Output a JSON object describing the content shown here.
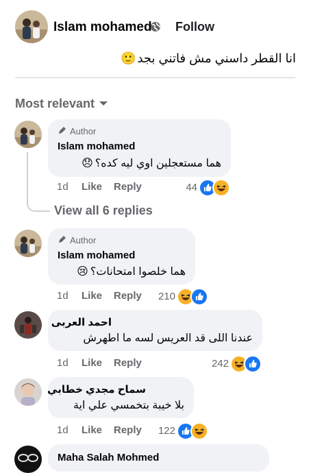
{
  "post": {
    "author": "Islam mohamed",
    "globe_icon": "globe-icon",
    "follow_label": "Follow",
    "text": "انا القطر داسني مش فاتني بجد",
    "emoji": "🙂"
  },
  "sort": {
    "label": "Most relevant",
    "icon": "caret-down-icon"
  },
  "comments": [
    {
      "author_badge": "Author",
      "name": "Islam mohamed",
      "text": "هما مستعجلين اوي ليه كده؟",
      "emoji": "😞",
      "time": "1d",
      "like": "Like",
      "reply": "Reply",
      "reaction_count": "44",
      "reactions": [
        "like",
        "haha"
      ]
    },
    {
      "author_badge": "Author",
      "name": "Islam mohamed",
      "text": "هما خلصوا امتحانات؟",
      "emoji": "😢",
      "time": "1d",
      "like": "Like",
      "reply": "Reply",
      "reaction_count": "210",
      "reactions": [
        "haha",
        "like"
      ]
    },
    {
      "name": "احمد العربى",
      "text": "عندنا اللى قد العريس لسه ما اطهرش",
      "time": "1d",
      "like": "Like",
      "reply": "Reply",
      "reaction_count": "242",
      "reactions": [
        "haha",
        "like"
      ]
    },
    {
      "name": "سماح مجدي خطابي",
      "text": "بلا خيبة بتخمسي علي اية",
      "time": "1d",
      "like": "Like",
      "reply": "Reply",
      "reaction_count": "122",
      "reactions": [
        "like",
        "haha"
      ]
    },
    {
      "name": "Maha Salah Mohmed"
    }
  ],
  "view_replies": "View all 6 replies",
  "colors": {
    "like_blue": "#1877f2",
    "haha_yellow": "#f7b125",
    "bubble_bg": "#f0f2f5",
    "meta_gray": "#65676b"
  }
}
